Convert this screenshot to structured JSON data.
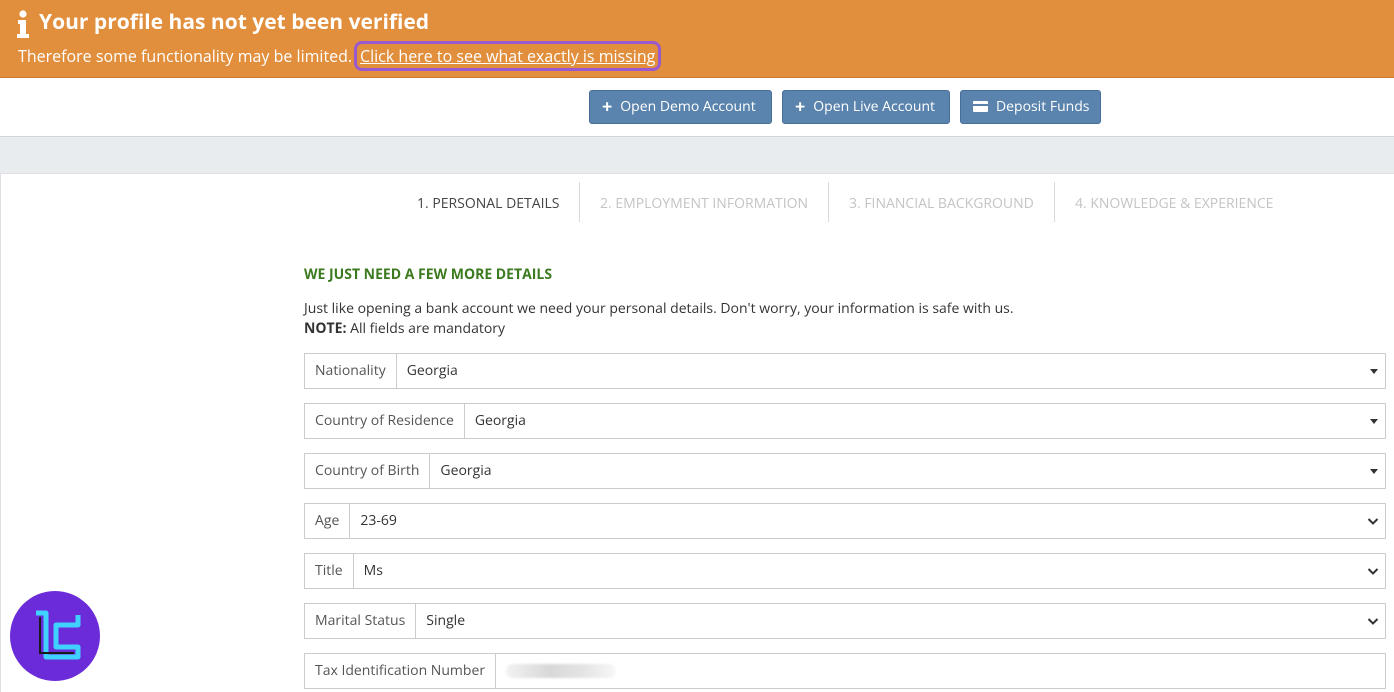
{
  "banner": {
    "title": "Your profile has not yet been verified",
    "subtitle": "Therefore some functionality may be limited.",
    "link": "Click here to see what exactly is missing",
    "icon": "info-icon"
  },
  "toolbar": {
    "demo_label": "Open Demo Account",
    "live_label": "Open Live Account",
    "deposit_label": "Deposit Funds"
  },
  "steps": [
    {
      "label": "1. PERSONAL DETAILS",
      "active": true
    },
    {
      "label": "2. EMPLOYMENT INFORMATION",
      "active": false
    },
    {
      "label": "3. FINANCIAL BACKGROUND",
      "active": false
    },
    {
      "label": "4. KNOWLEDGE & EXPERIENCE",
      "active": false
    }
  ],
  "form": {
    "heading": "WE JUST NEED A FEW MORE DETAILS",
    "intro": "Just like opening a bank account we need your personal details. Don't worry, your information is safe with us.",
    "note_label": "NOTE:",
    "note_text": " All fields are mandatory",
    "fields": [
      {
        "label": "Nationality",
        "value": "Georgia"
      },
      {
        "label": "Country of Residence",
        "value": "Georgia"
      },
      {
        "label": "Country of Birth",
        "value": "Georgia"
      },
      {
        "label": "Age",
        "value": "23-69"
      },
      {
        "label": "Title",
        "value": "Ms"
      },
      {
        "label": "Marital Status",
        "value": "Single"
      },
      {
        "label": "Tax Identification Number",
        "value": ""
      }
    ]
  },
  "colors": {
    "banner": "#e28f3d",
    "button": "#5a84ad",
    "heading_green": "#3b7a1e",
    "link_highlight": "#9b59d0"
  }
}
